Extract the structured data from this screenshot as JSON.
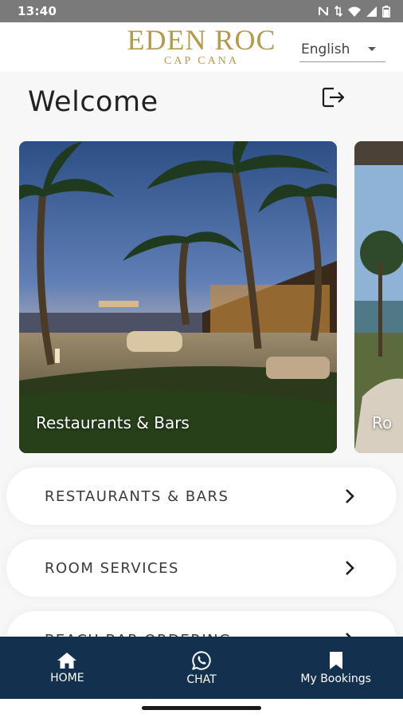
{
  "status_bar": {
    "time": "13:40",
    "icons": [
      "nfc-icon",
      "data-arrows-icon",
      "wifi-icon",
      "signal-icon",
      "battery-icon"
    ]
  },
  "header": {
    "brand_name": "EDEN ROC",
    "brand_sub": "CAP CANA",
    "language": "English",
    "brand_color": "#b49a4c"
  },
  "main": {
    "welcome": "Welcome",
    "carousel": [
      {
        "label": "Restaurants & Bars"
      },
      {
        "label": "Ro"
      }
    ],
    "menu": [
      {
        "label": "RESTAURANTS & BARS"
      },
      {
        "label": "ROOM SERVICES"
      },
      {
        "label": "BEACH BAR ORDERING"
      }
    ]
  },
  "bottom_nav": {
    "background": "#13314f",
    "items": [
      {
        "label": "HOME",
        "icon": "home-icon"
      },
      {
        "label": "CHAT",
        "icon": "whatsapp-icon"
      },
      {
        "label": "My Bookings",
        "icon": "bookmark-icon"
      }
    ]
  }
}
